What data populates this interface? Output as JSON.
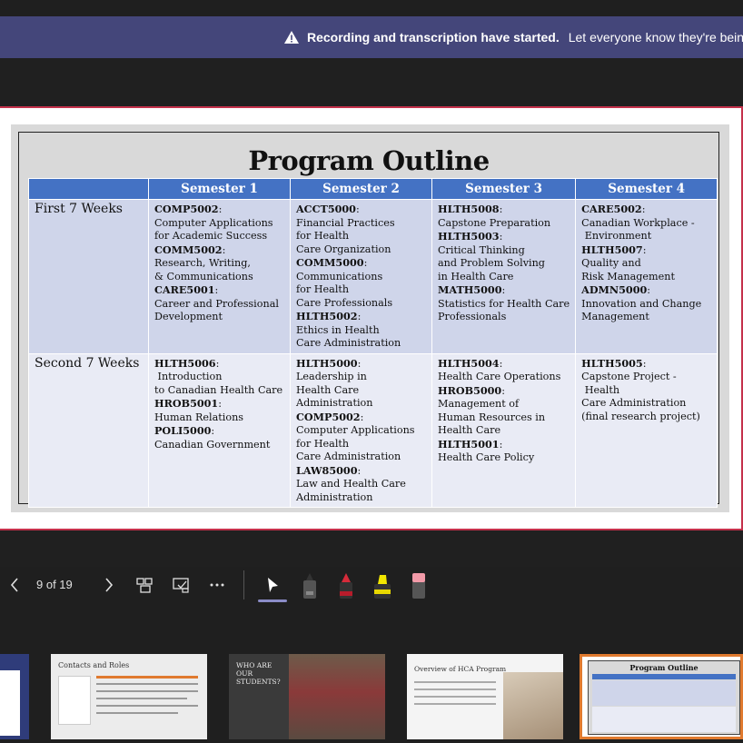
{
  "banner": {
    "strong": "Recording and transcription have started.",
    "rest": "Let everyone know they're being"
  },
  "slide": {
    "title": "Program Outline",
    "headers": [
      "Semester 1",
      "Semester 2",
      "Semester 3",
      "Semester 4"
    ],
    "rows": [
      {
        "label": "First 7 Weeks",
        "cells": [
          [
            {
              "code": "COMP5002",
              "rest": ":"
            },
            {
              "text": "Computer Applications"
            },
            {
              "text": "for Academic Success"
            },
            {
              "code": "COMM5002",
              "rest": ":"
            },
            {
              "text": "Research, Writing,"
            },
            {
              "text": "& Communications"
            },
            {
              "code": "CARE5001",
              "rest": ":"
            },
            {
              "text": "Career and Professional"
            },
            {
              "text": "Development"
            }
          ],
          [
            {
              "code": "ACCT5000",
              "rest": ":"
            },
            {
              "text": "Financial Practices"
            },
            {
              "text": "for Health"
            },
            {
              "text": "Care Organization"
            },
            {
              "code": "COMM5000",
              "rest": ":"
            },
            {
              "text": "Communications"
            },
            {
              "text": "for Health"
            },
            {
              "text": "Care Professionals"
            },
            {
              "code": "HLTH5002",
              "rest": ":"
            },
            {
              "text": "Ethics in Health"
            },
            {
              "text": "Care Administration"
            }
          ],
          [
            {
              "code": "HLTH5008",
              "rest": ":"
            },
            {
              "text": "Capstone Preparation"
            },
            {
              "code": "HLTH5003",
              "rest": ":"
            },
            {
              "text": "Critical Thinking"
            },
            {
              "text": "and Problem Solving"
            },
            {
              "text": "in Health Care"
            },
            {
              "code": "MATH5000",
              "rest": ":"
            },
            {
              "text": "Statistics for Health Care"
            },
            {
              "text": "Professionals"
            }
          ],
          [
            {
              "code": "CARE5002",
              "rest": ":"
            },
            {
              "text": "Canadian Workplace -"
            },
            {
              "text": " Environment"
            },
            {
              "code": "HLTH5007",
              "rest": ":"
            },
            {
              "text": "Quality and"
            },
            {
              "text": "Risk Management"
            },
            {
              "code": "ADMN5000",
              "rest": ":"
            },
            {
              "text": "Innovation and Change"
            },
            {
              "text": "Management"
            }
          ]
        ]
      },
      {
        "label": "Second 7 Weeks",
        "cells": [
          [
            {
              "code": "HLTH5006",
              "rest": ":"
            },
            {
              "text": " Introduction"
            },
            {
              "text": "to Canadian Health Care"
            },
            {
              "code": "HROB5001",
              "rest": ":"
            },
            {
              "text": "Human Relations"
            },
            {
              "code": "POLI5000",
              "rest": ":"
            },
            {
              "text": "Canadian Government"
            }
          ],
          [
            {
              "code": "HLTH5000",
              "rest": ":"
            },
            {
              "text": "Leadership in"
            },
            {
              "text": "Health Care"
            },
            {
              "text": "Administration"
            },
            {
              "code": "COMP5002",
              "rest": ":"
            },
            {
              "text": "Computer Applications"
            },
            {
              "text": "for Health"
            },
            {
              "text": "Care Administration"
            },
            {
              "code": "LAW85000",
              "rest": ":"
            },
            {
              "text": "Law and Health Care"
            },
            {
              "text": "Administration"
            }
          ],
          [
            {
              "code": "HLTH5004",
              "rest": ":"
            },
            {
              "text": "Health Care Operations"
            },
            {
              "code": "HROB5000",
              "rest": ":"
            },
            {
              "text": "Management of"
            },
            {
              "text": "Human Resources in"
            },
            {
              "text": "Health Care"
            },
            {
              "code": "HLTH5001",
              "rest": ":"
            },
            {
              "text": "Health Care Policy"
            }
          ],
          [
            {
              "code": "HLTH5005",
              "rest": ":"
            },
            {
              "text": "Capstone Project -"
            },
            {
              "text": " Health"
            },
            {
              "text": "Care Administration"
            },
            {
              "text": "(final research project)"
            }
          ]
        ]
      }
    ]
  },
  "controls": {
    "page_indicator": "9 of 19"
  },
  "thumbnails": [
    {
      "title": ""
    },
    {
      "title": "Contacts and Roles"
    },
    {
      "title": "WHO ARE OUR STUDENTS?"
    },
    {
      "title": "Overview of HCA Program"
    },
    {
      "title": "Program Outline"
    }
  ],
  "colors": {
    "banner": "#44467a",
    "table_header": "#4472c4",
    "row1": "#cfd5ea",
    "row2": "#e9ebf5",
    "slide_border": "#c4314b",
    "selected_thumb": "#e07a2f"
  }
}
